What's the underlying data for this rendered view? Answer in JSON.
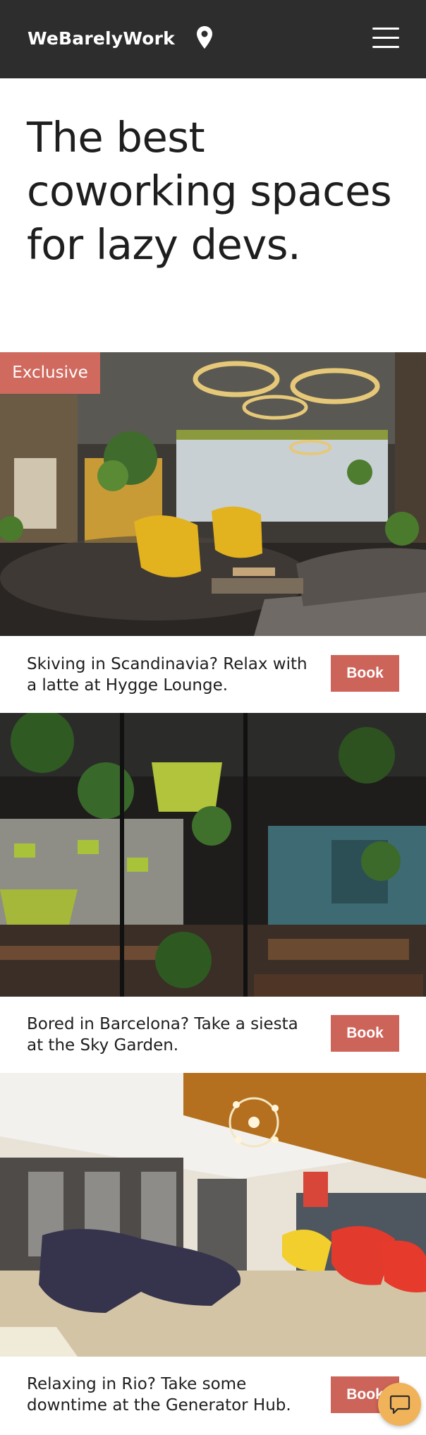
{
  "header": {
    "brand": "WeBarelyWork",
    "location_icon": "map-pin-icon",
    "menu_icon": "hamburger-menu-icon"
  },
  "hero": {
    "title": "The best coworking spaces for lazy devs."
  },
  "listings": [
    {
      "badge": "Exclusive",
      "description": "Skiving in Scandinavia? Relax with a latte at Hygge Lounge.",
      "button": "Book",
      "image": "lounge with ring lamps and yellow chairs"
    },
    {
      "description": "Bored in Barcelona? Take a siesta at the Sky Garden.",
      "button": "Book",
      "image": "garden cafe with hanging plants"
    },
    {
      "description": "Relaxing in Rio? Take some downtime at the Generator Hub.",
      "button": "Book",
      "image": "lobby with curved sofa and red chairs"
    }
  ],
  "chat": {
    "icon": "chat-bubble-icon"
  },
  "colors": {
    "header_bg": "#2d2d2d",
    "accent": "#cd645a",
    "chat": "#f0b35a"
  }
}
